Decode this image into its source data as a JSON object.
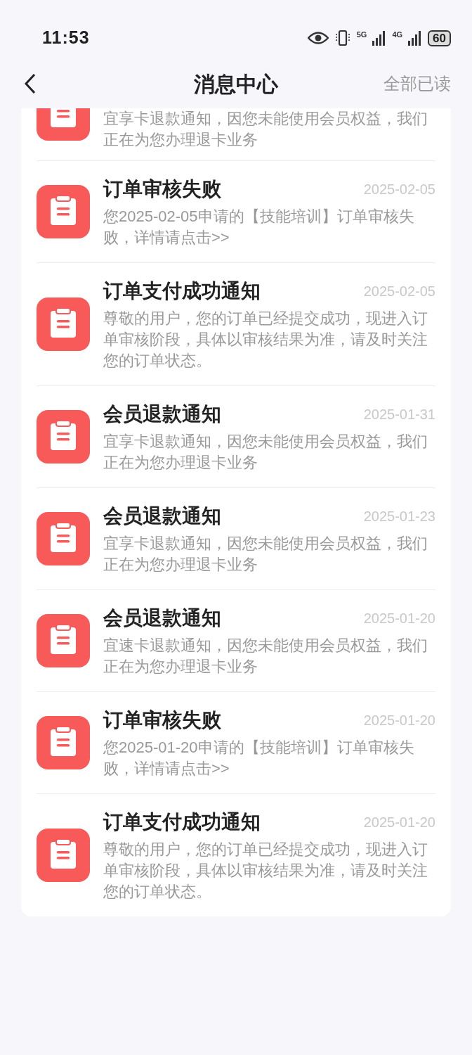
{
  "status_bar": {
    "time": "11:53",
    "network_1": "5G",
    "network_2": "4G",
    "battery": "60"
  },
  "header": {
    "title": "消息中心",
    "action": "全部已读"
  },
  "messages": [
    {
      "kind": "partial",
      "body": "宜享卡退款通知，因您未能使用会员权益，我们正在为您办理退卡业务"
    },
    {
      "kind": "full",
      "title": "订单审核失败",
      "date": "2025-02-05",
      "body": "您2025-02-05申请的【技能培训】订单审核失败，详情请点击>>"
    },
    {
      "kind": "full",
      "title": "订单支付成功通知",
      "date": "2025-02-05",
      "body": "尊敬的用户，您的订单已经提交成功，现进入订单审核阶段，具体以审核结果为准，请及时关注您的订单状态。"
    },
    {
      "kind": "full",
      "title": "会员退款通知",
      "date": "2025-01-31",
      "body": "宜享卡退款通知，因您未能使用会员权益，我们正在为您办理退卡业务"
    },
    {
      "kind": "full",
      "title": "会员退款通知",
      "date": "2025-01-23",
      "body": "宜享卡退款通知，因您未能使用会员权益，我们正在为您办理退卡业务"
    },
    {
      "kind": "full",
      "title": "会员退款通知",
      "date": "2025-01-20",
      "body": "宜速卡退款通知，因您未能使用会员权益，我们正在为您办理退卡业务"
    },
    {
      "kind": "full",
      "title": "订单审核失败",
      "date": "2025-01-20",
      "body": "您2025-01-20申请的【技能培训】订单审核失败，详情请点击>>"
    },
    {
      "kind": "full",
      "title": "订单支付成功通知",
      "date": "2025-01-20",
      "body": "尊敬的用户，您的订单已经提交成功，现进入订单审核阶段，具体以审核结果为准，请及时关注您的订单状态。"
    }
  ]
}
